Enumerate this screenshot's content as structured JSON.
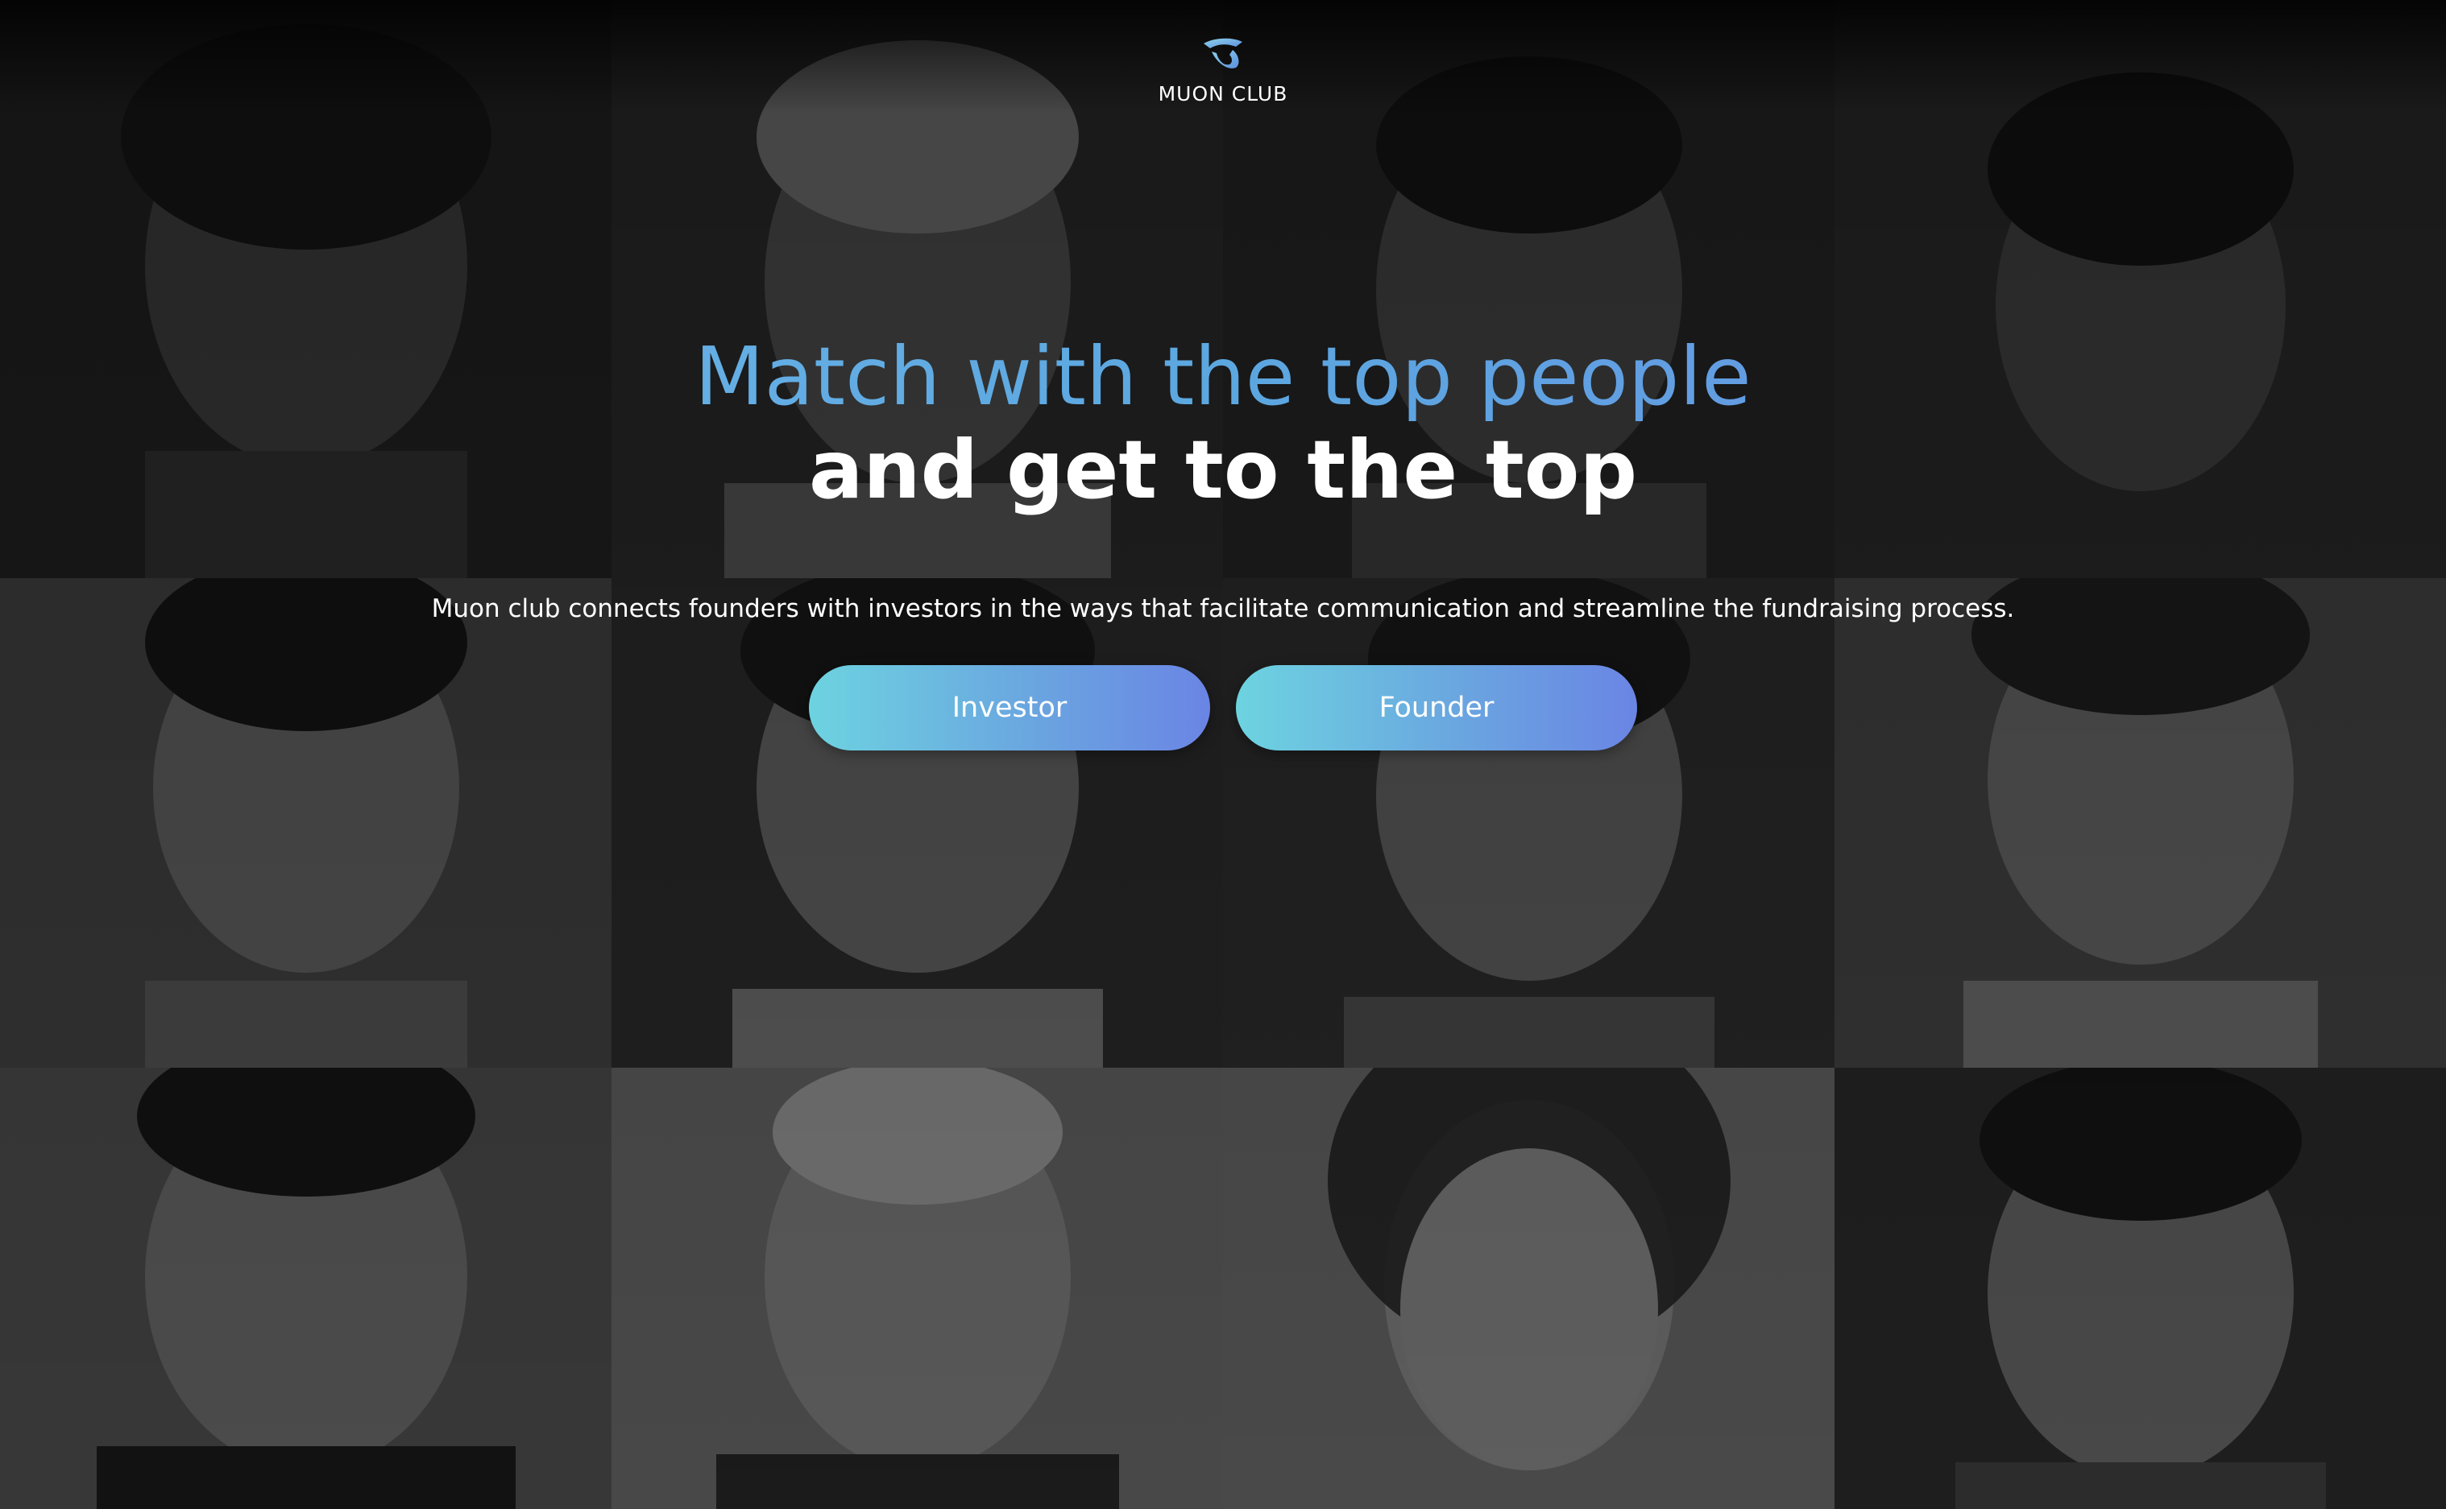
{
  "brand": {
    "name": "MUON CLUB",
    "logo_icon": "muon-logo-icon",
    "accent_color": "#5ca7e0"
  },
  "hero": {
    "headline_line1": "Match with the top people",
    "headline_line2": "and get to the top",
    "subtitle": "Muon club connects founders with investors in the ways that facilitate communication and streamline the fundraising process."
  },
  "actions": {
    "investor_label": "Investor",
    "founder_label": "Founder"
  },
  "background": {
    "description_icon": "people-photo-grid"
  }
}
